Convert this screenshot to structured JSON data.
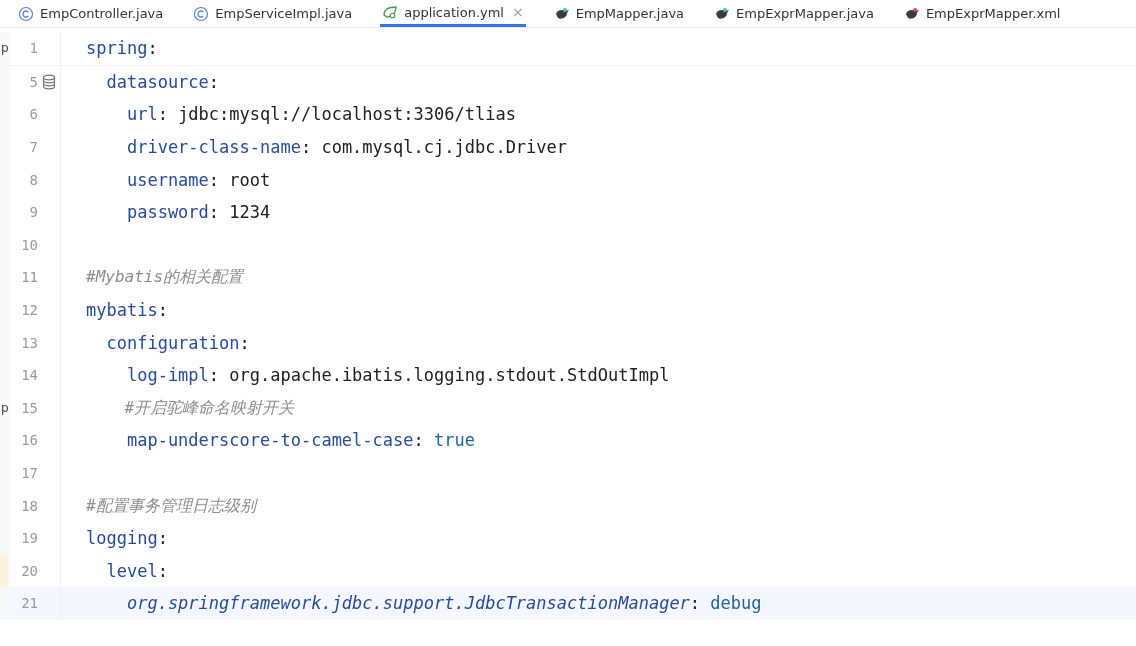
{
  "tabs": [
    {
      "label": "EmpController.java",
      "kind": "class",
      "selected": false
    },
    {
      "label": "EmpServiceImpl.java",
      "kind": "class",
      "selected": false
    },
    {
      "label": "application.yml",
      "kind": "yaml",
      "selected": true,
      "close": "×"
    },
    {
      "label": "EmpMapper.java",
      "kind": "mapper",
      "selected": false
    },
    {
      "label": "EmpExprMapper.java",
      "kind": "mapper",
      "selected": false
    },
    {
      "label": "EmpExprMapper.xml",
      "kind": "mapper-xml",
      "selected": false
    }
  ],
  "editor": {
    "lines": [
      {
        "number": "1",
        "side_text": "p",
        "fold_below": true,
        "tokens": [
          {
            "kind": "key",
            "text": "spring"
          },
          {
            "kind": "plain",
            "text": ":"
          }
        ]
      },
      {
        "number": "5",
        "gutter_marker": true,
        "tokens": [
          {
            "kind": "key",
            "text": "  datasource"
          },
          {
            "kind": "plain",
            "text": ":"
          }
        ]
      },
      {
        "number": "6",
        "tokens": [
          {
            "kind": "key",
            "text": "    url"
          },
          {
            "kind": "plain",
            "text": ": jdbc:mysql://localhost:3306/tlias"
          }
        ]
      },
      {
        "number": "7",
        "tokens": [
          {
            "kind": "key",
            "text": "    driver-class-name"
          },
          {
            "kind": "plain",
            "text": ": com.mysql.cj.jdbc.Driver"
          }
        ]
      },
      {
        "number": "8",
        "tokens": [
          {
            "kind": "key",
            "text": "    username"
          },
          {
            "kind": "plain",
            "text": ": root"
          }
        ]
      },
      {
        "number": "9",
        "tokens": [
          {
            "kind": "key",
            "text": "    password"
          },
          {
            "kind": "plain",
            "text": ": 1234"
          }
        ]
      },
      {
        "number": "10"
      },
      {
        "number": "11",
        "tokens": [
          {
            "kind": "comment",
            "text": "#Mybatis的相关配置"
          }
        ]
      },
      {
        "number": "12",
        "tokens": [
          {
            "kind": "key",
            "text": "mybatis"
          },
          {
            "kind": "plain",
            "text": ":"
          }
        ]
      },
      {
        "number": "13",
        "tokens": [
          {
            "kind": "key",
            "text": "  configuration"
          },
          {
            "kind": "plain",
            "text": ":"
          }
        ]
      },
      {
        "number": "14",
        "tokens": [
          {
            "kind": "key",
            "text": "    log-impl"
          },
          {
            "kind": "plain",
            "text": ": org.apache.ibatis.logging.stdout.StdOutImpl"
          }
        ]
      },
      {
        "number": "15",
        "side_text": "p",
        "tokens": [
          {
            "kind": "comment",
            "text": "    #开启驼峰命名映射开关"
          }
        ]
      },
      {
        "number": "16",
        "tokens": [
          {
            "kind": "key",
            "text": "    map-underscore-to-camel-case"
          },
          {
            "kind": "plain",
            "text": ": "
          },
          {
            "kind": "literal",
            "text": "true"
          }
        ]
      },
      {
        "number": "17"
      },
      {
        "number": "18",
        "tokens": [
          {
            "kind": "comment",
            "text": "#配置事务管理日志级别"
          }
        ]
      },
      {
        "number": "19",
        "tokens": [
          {
            "kind": "key",
            "text": "logging"
          },
          {
            "kind": "plain",
            "text": ":"
          }
        ]
      },
      {
        "number": "20",
        "marked": true,
        "tokens": [
          {
            "kind": "key",
            "text": "  level"
          },
          {
            "kind": "plain",
            "text": ":"
          }
        ]
      },
      {
        "number": "21",
        "current": true,
        "tokens": [
          {
            "kind": "key-italic",
            "text": "    org.springframework.jdbc.support.JdbcTransactionManager"
          },
          {
            "kind": "plain",
            "text": ": "
          },
          {
            "kind": "literal",
            "text": "debug"
          }
        ]
      }
    ]
  }
}
